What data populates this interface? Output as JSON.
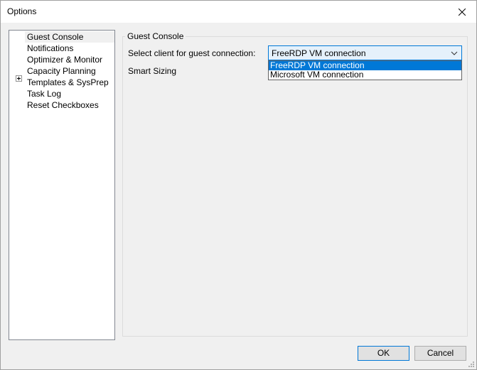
{
  "window": {
    "title": "Options"
  },
  "tree": {
    "items": [
      {
        "label": "Guest Console",
        "selected": true,
        "expandable": false
      },
      {
        "label": "Notifications",
        "selected": false,
        "expandable": true
      },
      {
        "label": "Optimizer & Monitor",
        "selected": false,
        "expandable": false
      },
      {
        "label": "Capacity Planning",
        "selected": false,
        "expandable": false
      },
      {
        "label": "Templates & SysPrep",
        "selected": false,
        "expandable": false
      },
      {
        "label": "Task Log",
        "selected": false,
        "expandable": false
      },
      {
        "label": "Reset Checkboxes",
        "selected": false,
        "expandable": false
      }
    ]
  },
  "panel": {
    "group_title": "Guest Console",
    "client_label": "Select client for guest connection:",
    "smart_sizing_label": "Smart Sizing",
    "client_combo": {
      "value": "FreeRDP VM connection",
      "options": [
        "FreeRDP VM connection",
        "Microsoft VM connection"
      ],
      "highlighted_index": 0
    }
  },
  "buttons": {
    "ok": "OK",
    "cancel": "Cancel"
  },
  "colors": {
    "accent": "#0078d7",
    "selection": "#f0f0f0"
  },
  "icons": {
    "close": "close-icon",
    "expander": "plus-expander-icon",
    "combo_arrow": "chevron-down-icon"
  }
}
